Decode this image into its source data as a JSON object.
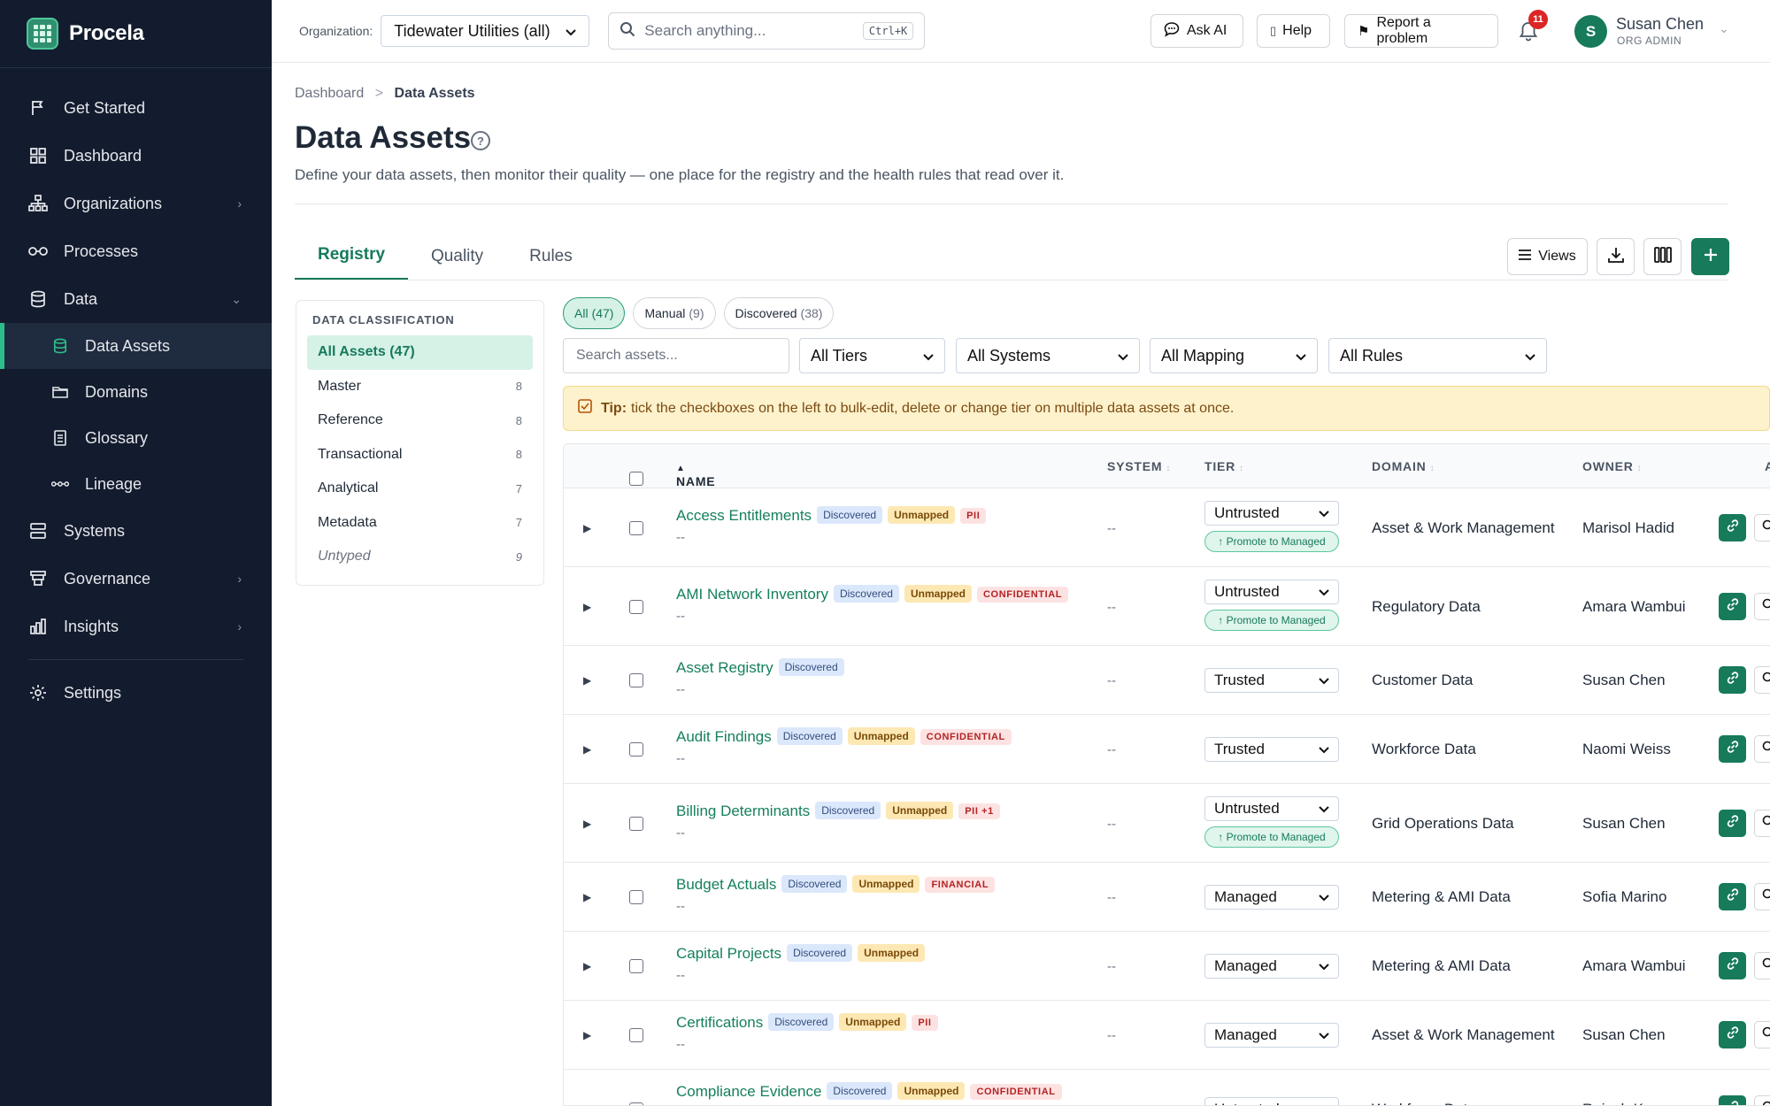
{
  "app": {
    "name": "Procela"
  },
  "sidebar": {
    "items": [
      {
        "label": "Get Started",
        "icon": "flag-icon"
      },
      {
        "label": "Dashboard",
        "icon": "grid-icon"
      },
      {
        "label": "Organizations",
        "icon": "org-tree-icon"
      },
      {
        "label": "Processes",
        "icon": "link-loop-icon"
      },
      {
        "label": "Data",
        "icon": "database-icon"
      }
    ],
    "sub_items": [
      {
        "label": "Data Assets",
        "icon": "database-icon",
        "active": true
      },
      {
        "label": "Domains",
        "icon": "folder-icon"
      },
      {
        "label": "Glossary",
        "icon": "book-icon"
      },
      {
        "label": "Lineage",
        "icon": "lineage-icon"
      }
    ],
    "lower_items": [
      {
        "label": "Systems",
        "icon": "server-icon"
      },
      {
        "label": "Governance",
        "icon": "governance-icon"
      },
      {
        "label": "Insights",
        "icon": "bar-chart-icon"
      }
    ],
    "settings": {
      "label": "Settings",
      "icon": "gear-icon"
    }
  },
  "topbar": {
    "org_label": "Organization:",
    "org_value": "Tidewater Utilities (all)",
    "search_placeholder": "Search anything...",
    "search_shortcut": "Ctrl+K",
    "ask_ai": "Ask AI",
    "help": "Help",
    "report": "Report a problem",
    "notifications_count": "11",
    "user": {
      "initial": "S",
      "name": "Susan Chen",
      "role": "ORG ADMIN"
    }
  },
  "page": {
    "breadcrumb": {
      "parent": "Dashboard",
      "sep": ">",
      "current": "Data Assets"
    },
    "title": "Data Assets",
    "subtitle": "Define your data assets, then monitor their quality — one place for the registry and the health rules that read over it.",
    "tabs": [
      "Registry",
      "Quality",
      "Rules"
    ],
    "views_label": "Views"
  },
  "classification": {
    "heading": "DATA CLASSIFICATION",
    "items": [
      {
        "label": "All Assets (47)",
        "count": ""
      },
      {
        "label": "Master",
        "count": "8"
      },
      {
        "label": "Reference",
        "count": "8"
      },
      {
        "label": "Transactional",
        "count": "8"
      },
      {
        "label": "Analytical",
        "count": "7"
      },
      {
        "label": "Metadata",
        "count": "7"
      },
      {
        "label": "Untyped",
        "count": "9"
      }
    ]
  },
  "pills": [
    {
      "label": "All",
      "count": "(47)"
    },
    {
      "label": "Manual",
      "count": "(9)"
    },
    {
      "label": "Discovered",
      "count": "(38)"
    }
  ],
  "filters": {
    "search_placeholder": "Search assets...",
    "tiers": "All Tiers",
    "systems": "All Systems",
    "mapping": "All Mapping",
    "rules": "All Rules"
  },
  "tip": {
    "label": "Tip:",
    "text": "tick the checkboxes on the left to bulk-edit, delete or change tier on multiple data assets at once."
  },
  "table": {
    "columns": {
      "name": "NAME",
      "name_sort": "▲",
      "system": "SYSTEM",
      "tier": "TIER",
      "domain": "DOMAIN",
      "owner": "OWNER",
      "actions": "A"
    },
    "promote_label": "↑ Promote to Managed",
    "rows": [
      {
        "name": "Access Entitlements",
        "sub": "--",
        "badges": [
          "Discovered",
          "Unmapped",
          "PII"
        ],
        "system": "--",
        "tier": "Untrusted",
        "promote": true,
        "domain": "Asset & Work Management",
        "owner": "Marisol Hadid"
      },
      {
        "name": "AMI Network Inventory",
        "sub": "--",
        "badges": [
          "Discovered",
          "Unmapped",
          "CONFIDENTIAL"
        ],
        "system": "--",
        "tier": "Untrusted",
        "promote": true,
        "domain": "Regulatory Data",
        "owner": "Amara Wambui"
      },
      {
        "name": "Asset Registry",
        "sub": "--",
        "badges": [
          "Discovered"
        ],
        "system": "--",
        "tier": "Trusted",
        "promote": false,
        "domain": "Customer Data",
        "owner": "Susan Chen"
      },
      {
        "name": "Audit Findings",
        "sub": "--",
        "badges": [
          "Discovered",
          "Unmapped",
          "CONFIDENTIAL"
        ],
        "system": "--",
        "tier": "Trusted",
        "promote": false,
        "domain": "Workforce Data",
        "owner": "Naomi Weiss"
      },
      {
        "name": "Billing Determinants",
        "sub": "--",
        "badges": [
          "Discovered",
          "Unmapped",
          "PII +1"
        ],
        "system": "--",
        "tier": "Untrusted",
        "promote": true,
        "domain": "Grid Operations Data",
        "owner": "Susan Chen"
      },
      {
        "name": "Budget Actuals",
        "sub": "--",
        "badges": [
          "Discovered",
          "Unmapped",
          "FINANCIAL"
        ],
        "system": "--",
        "tier": "Managed",
        "promote": false,
        "domain": "Metering & AMI Data",
        "owner": "Sofia Marino"
      },
      {
        "name": "Capital Projects",
        "sub": "--",
        "badges": [
          "Discovered",
          "Unmapped"
        ],
        "system": "--",
        "tier": "Managed",
        "promote": false,
        "domain": "Metering & AMI Data",
        "owner": "Amara Wambui"
      },
      {
        "name": "Certifications",
        "sub": "--",
        "badges": [
          "Discovered",
          "Unmapped",
          "PII"
        ],
        "system": "--",
        "tier": "Managed",
        "promote": false,
        "domain": "Asset & Work Management",
        "owner": "Susan Chen"
      },
      {
        "name": "Compliance Evidence",
        "sub": "--",
        "badges": [
          "Discovered",
          "Unmapped",
          "CONFIDENTIAL"
        ],
        "system": "--",
        "tier": "Untrusted",
        "promote": false,
        "domain": "Workforce Data",
        "owner": "Rajesh Kapoor"
      }
    ]
  },
  "colors": {
    "accent": "#167a5b",
    "sidebar": "#131c2e",
    "tip_bg": "#fdf2cc"
  }
}
